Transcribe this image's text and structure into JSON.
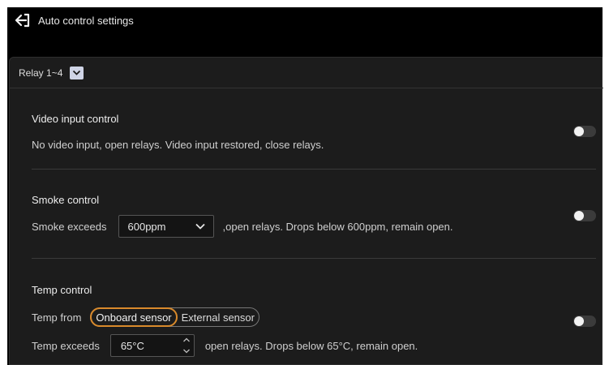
{
  "header": {
    "title": "Auto control settings"
  },
  "relay": {
    "label": "Relay 1~4"
  },
  "video": {
    "title": "Video input control",
    "description": "No video input, open relays. Video input restored, close relays.",
    "enabled": false
  },
  "smoke": {
    "title": "Smoke control",
    "prefix": "Smoke exceeds",
    "threshold": "600ppm",
    "suffix": ",open relays. Drops below 600ppm, remain open.",
    "enabled": false
  },
  "temp": {
    "title": "Temp control",
    "source_label": "Temp from",
    "sources": [
      "Onboard sensor",
      "External sensor"
    ],
    "selected_source": "Onboard sensor",
    "prefix": "Temp exceeds",
    "threshold": "65°C",
    "suffix": "open relays. Drops below 65°C, remain open.",
    "enabled": false
  },
  "colors": {
    "accent": "#d98a2b",
    "background": "#1c1c1c",
    "toggle_off": "#3b3b3b"
  }
}
